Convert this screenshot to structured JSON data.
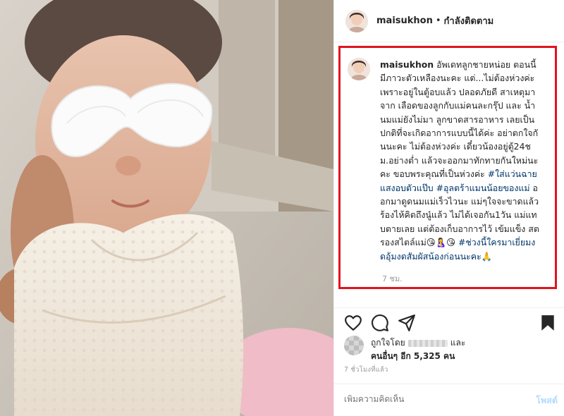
{
  "header": {
    "username": "maisukhon",
    "separator": "•",
    "follow_status": "กำลังติดตาม"
  },
  "caption": {
    "username": "maisukhon",
    "text_1": " อัพเดทลูกชายหน่อย ตอนนี้มีภาวะตัวเหลืองนะคะ แต่...ไม่ต้องห่วงค่ะ เพราะอยู่ในตู้อบแล้ว ปลอดภัยดี สาเหตุมาจาก เลือดของลูกกับแม่คนละกรุ๊ป และ น้ำนมแม่ยังไม่มา ลูกขาดสารอาหาร เลยเป็นปกติที่จะเกิดอาการแบบนี้ได้ค่ะ อย่าตกใจกันนะคะ ไม่ต้องห่วงค่ะ เดี๋ยวน้องอยู่ตู้24ชม.อย่างต่ำ แล้วจะออกมาทักทายกันใหม่นะคะ ขอบพระคุณที่เป็นห่วงค่ะ ",
    "hashtag_1": "#ใส่แว่นฉายแสงอบตัวแป๊บ",
    "hashtag_2": "#อุลตร้าแมนน้อยของแม่",
    "text_2": " ออกมาดูดนมแม่เร็วไวนะ แม่ๆใจจะขาดแล้ว ร้องไห้คิดถึงนู๋แล้ว ไม่ได้เจอกัน1วัน แม่แทบตายเลย แต่ต้องเก็บอาการไว้ เข้มแข็ง สตรองสไตล์แม่😘🤱😘 ",
    "hashtag_3": "#ช่วงนี้ใครมาเยี่ยมงดอุ้มงดสัมผัสน้องก่อนนะคะ",
    "text_3": "🙏",
    "time": "7 ชม."
  },
  "likes": {
    "prefix": "ถูกใจโดย",
    "suffix": "และ",
    "others_label": "คนอื่นๆ อีก 5,325 คน"
  },
  "post_time": "7 ชั่วโมงที่แล้ว",
  "comment": {
    "placeholder": "เพิ่มความคิดเห็น",
    "post_label": "โพสต์"
  },
  "icons": {
    "like": "heart-icon",
    "comment": "comment-icon",
    "share": "share-icon",
    "save": "bookmark-icon"
  },
  "colors": {
    "highlight_border": "#e0141e",
    "hashtag": "#003569",
    "post_button": "#b3dbff"
  }
}
